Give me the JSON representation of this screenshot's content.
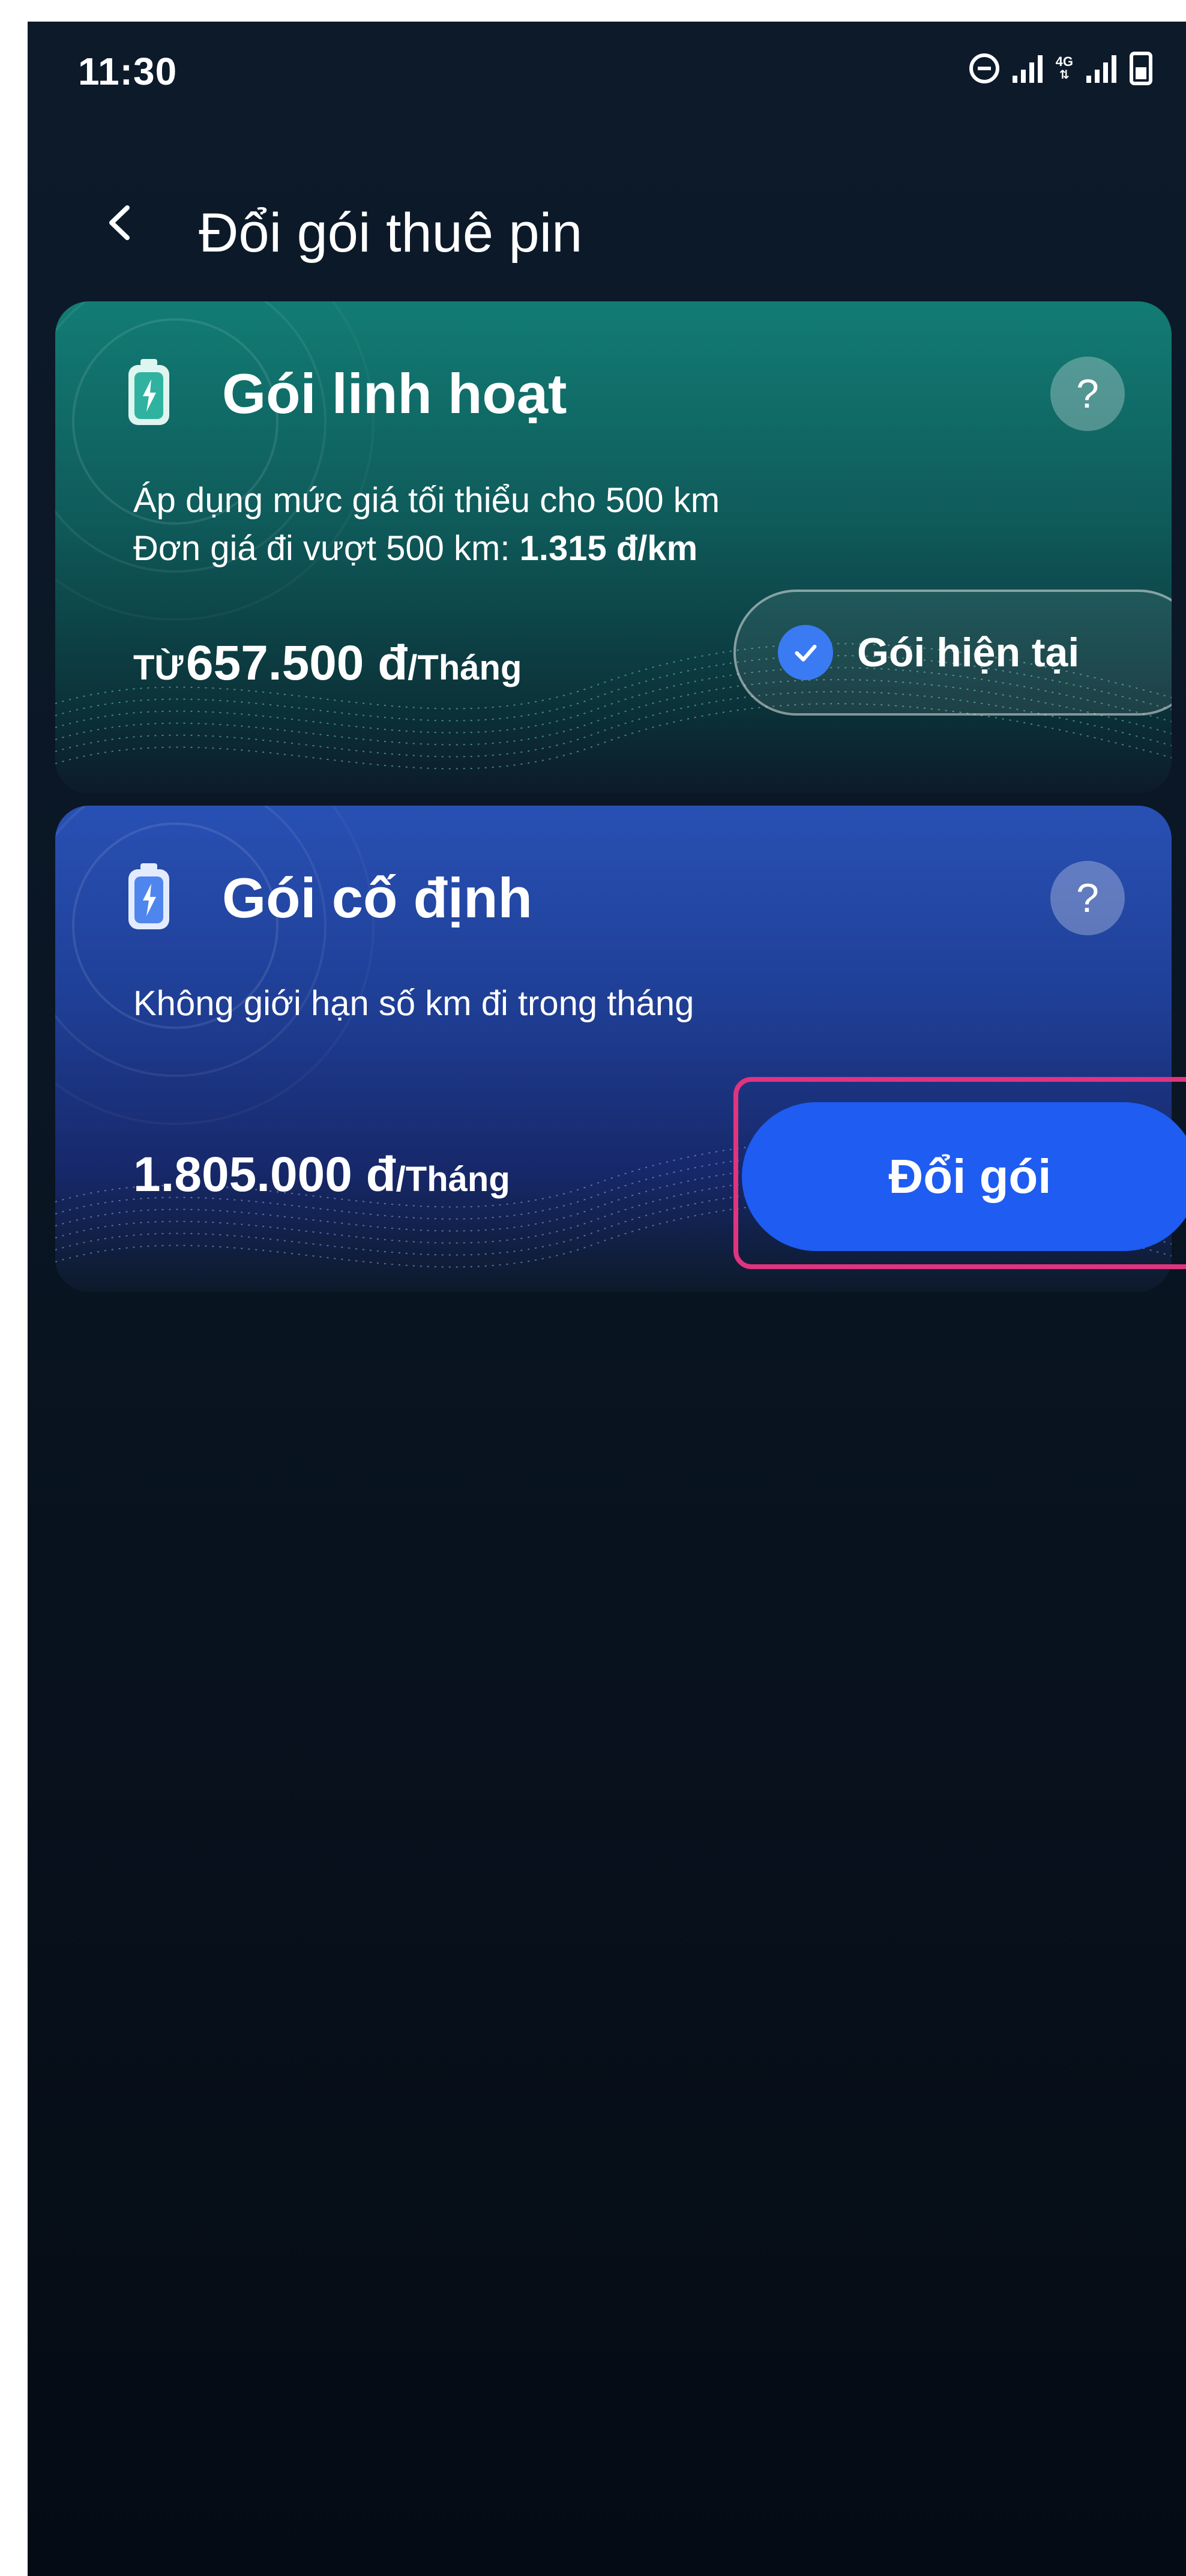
{
  "status_bar": {
    "time": "11:30",
    "network_label": "4G",
    "icons": [
      "do-not-disturb-icon",
      "signal-icon",
      "signal-4g-icon",
      "battery-icon"
    ]
  },
  "header": {
    "title": "Đổi gói thuê pin",
    "back_icon": "chevron-left-icon"
  },
  "plans": [
    {
      "title": "Gói linh hoạt",
      "icon": "battery-icon",
      "help": "?",
      "desc_line1": "Áp dụng mức giá tối thiểu cho 500 km",
      "desc_line2_prefix": "Đơn giá đi vượt 500 km: ",
      "desc_line2_value": "1.315 đ/km",
      "price_prefix": "TỪ",
      "price_amount": "657.500 đ",
      "price_unit": "/Tháng",
      "status_label": "Gói hiện tại",
      "status_icon": "check-icon",
      "accent_color": "#127c74"
    },
    {
      "title": "Gói cố định",
      "icon": "battery-icon",
      "help": "?",
      "desc_line1": "Không giới hạn số km đi trong tháng",
      "price_amount": "1.805.000 đ",
      "price_unit": "/Tháng",
      "action_label": "Đổi gói",
      "accent_color": "#2850b4"
    }
  ],
  "colors": {
    "background": "#0a1624",
    "primary_button": "#1e5cf2",
    "highlight": "#e0347e",
    "check": "#3a7bf4"
  }
}
